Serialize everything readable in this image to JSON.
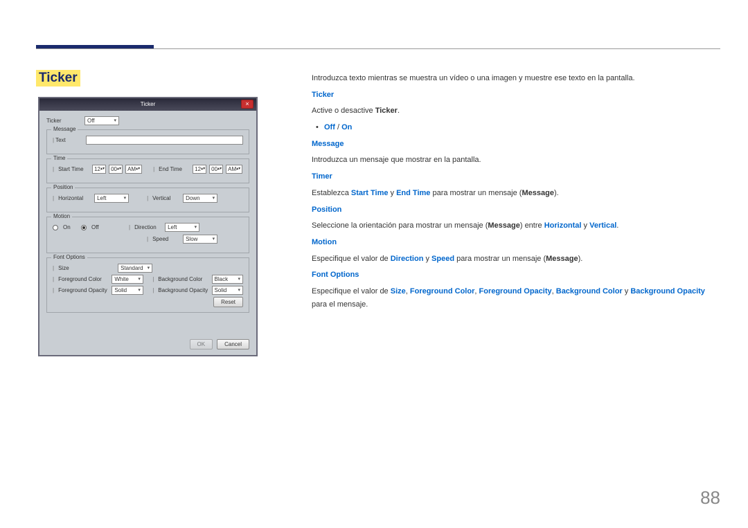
{
  "page_number": "88",
  "heading": "Ticker",
  "window": {
    "title": "Ticker",
    "close_glyph": "×",
    "ticker_label": "Ticker",
    "ticker_value": "Off",
    "message_legend": "Message",
    "message_text_label": "Text",
    "message_text_value": "",
    "time_legend": "Time",
    "start_time_label": "Start Time",
    "start_h": "12",
    "start_m": "00",
    "start_ampm": "AM",
    "end_time_label": "End Time",
    "end_h": "12",
    "end_m": "00",
    "end_ampm": "AM",
    "position_legend": "Position",
    "horizontal_label": "Horizontal",
    "horizontal_value": "Left",
    "vertical_label": "Vertical",
    "vertical_value": "Down",
    "motion_legend": "Motion",
    "motion_on": "On",
    "motion_off": "Off",
    "direction_label": "Direction",
    "direction_value": "Left",
    "speed_label": "Speed",
    "speed_value": "Slow",
    "font_legend": "Font Options",
    "size_label": "Size",
    "size_value": "Standard",
    "fgcolor_label": "Foreground Color",
    "fgcolor_value": "White",
    "fgopacity_label": "Foreground Opacity",
    "fgopacity_value": "Solid",
    "bgcolor_label": "Background Color",
    "bgcolor_value": "Black",
    "bgopacity_label": "Background Opacity",
    "bgopacity_value": "Solid",
    "reset_btn": "Reset",
    "ok_btn": "OK",
    "cancel_btn": "Cancel"
  },
  "text": {
    "intro": "Introduzca texto mientras se muestra un vídeo o una imagen y muestre ese texto en la pantalla.",
    "ticker_h": "Ticker",
    "ticker_p1a": "Active o desactive ",
    "ticker_p1b": "Ticker",
    "ticker_p1c": ".",
    "off": "Off",
    "slash": " / ",
    "on": "On",
    "message_h": "Message",
    "message_p": "Introduzca un mensaje que mostrar en la pantalla.",
    "timer_h": "Timer",
    "timer_a": "Establezca ",
    "timer_b": "Start Time",
    "timer_c": " y ",
    "timer_d": "End Time",
    "timer_e": " para mostrar un mensaje (",
    "timer_f": "Message",
    "timer_g": ").",
    "position_h": "Position",
    "pos_a": "Seleccione la orientación para mostrar un mensaje (",
    "pos_b": "Message",
    "pos_c": ") entre ",
    "pos_d": "Horizontal",
    "pos_e": " y ",
    "pos_f": "Vertical",
    "pos_g": ".",
    "motion_h": "Motion",
    "mot_a": "Especifique el valor de ",
    "mot_b": "Direction",
    "mot_c": " y ",
    "mot_d": "Speed",
    "mot_e": " para mostrar un mensaje (",
    "mot_f": "Message",
    "mot_g": ").",
    "font_h": "Font Options",
    "font_a": "Especifique el valor de ",
    "font_b": "Size",
    "font_c": ", ",
    "font_d": "Foreground Color",
    "font_e": ", ",
    "font_f": "Foreground Opacity",
    "font_g": ", ",
    "font_h2": "Background Color",
    "font_i": " y ",
    "font_j": "Background Opacity",
    "font_k": " para el mensaje."
  }
}
